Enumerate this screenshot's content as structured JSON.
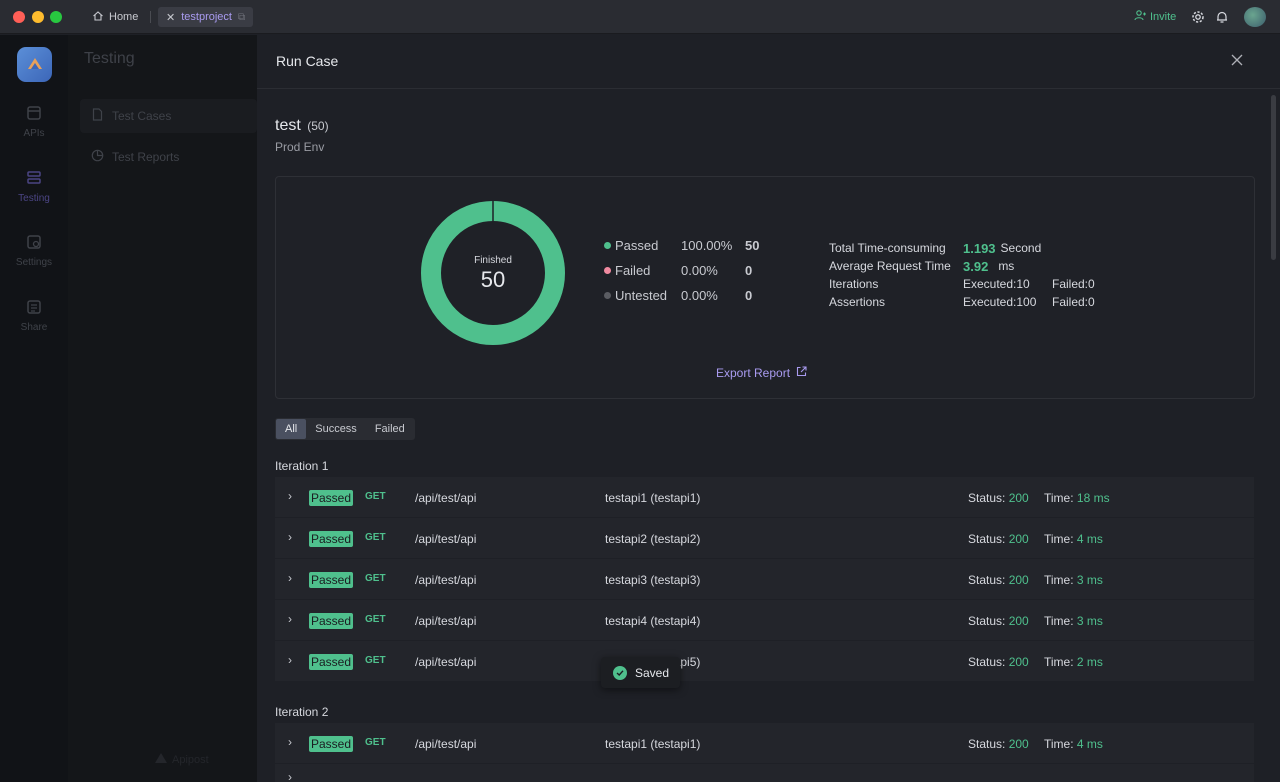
{
  "titlebar": {
    "home_tab": "Home",
    "project_tab": "testproject",
    "invite_label": "Invite"
  },
  "rail": {
    "items": [
      {
        "label": "APIs",
        "icon": "api-icon"
      },
      {
        "label": "Testing",
        "icon": "testing-icon"
      },
      {
        "label": "Settings",
        "icon": "settings-icon"
      },
      {
        "label": "Share",
        "icon": "share-icon"
      }
    ]
  },
  "sidebar": {
    "title": "Testing",
    "items": [
      {
        "label": "Test Cases",
        "icon": "document-icon"
      },
      {
        "label": "Test Reports",
        "icon": "pie-chart-icon"
      }
    ],
    "brand": "Apipost"
  },
  "drawer": {
    "title": "Run Case",
    "case_name": "test",
    "case_count": "(50)",
    "env": "Prod Env"
  },
  "summary": {
    "donut_label": "Finished",
    "donut_value": "50",
    "passed_fraction": 1.0,
    "colors": {
      "passed": "#4fc08d",
      "failed": "#f08aa0",
      "untested": "#5a5c62"
    },
    "legend": [
      {
        "name": "Passed",
        "pct": "100.00%",
        "count": "50"
      },
      {
        "name": "Failed",
        "pct": "0.00%",
        "count": "0"
      },
      {
        "name": "Untested",
        "pct": "0.00%",
        "count": "0"
      }
    ],
    "stats": {
      "time_label": "Total Time-consuming",
      "time_value": "1.193",
      "time_unit": "Second",
      "avg_label": "Average Request Time",
      "avg_value": "3.92",
      "avg_unit": "ms",
      "iter_label": "Iterations",
      "iter_executed": "Executed:10",
      "iter_failed": "Failed:0",
      "assert_label": "Assertions",
      "assert_executed": "Executed:100",
      "assert_failed": "Failed:0"
    },
    "export_label": "Export Report"
  },
  "filter": {
    "all": "All",
    "success": "Success",
    "failed": "Failed"
  },
  "row_labels": {
    "status": "Status:",
    "time": "Time:"
  },
  "iterations": [
    {
      "title": "Iteration 1",
      "rows": [
        {
          "badge": "Passed",
          "method": "GET",
          "path": "/api/test/api",
          "name": "testapi1 (testapi1)",
          "status": "200",
          "time": "18 ms"
        },
        {
          "badge": "Passed",
          "method": "GET",
          "path": "/api/test/api",
          "name": "testapi2 (testapi2)",
          "status": "200",
          "time": "4 ms"
        },
        {
          "badge": "Passed",
          "method": "GET",
          "path": "/api/test/api",
          "name": "testapi3 (testapi3)",
          "status": "200",
          "time": "3 ms"
        },
        {
          "badge": "Passed",
          "method": "GET",
          "path": "/api/test/api",
          "name": "testapi4 (testapi4)",
          "status": "200",
          "time": "3 ms"
        },
        {
          "badge": "Passed",
          "method": "GET",
          "path": "/api/test/api",
          "name": "testapi5 (testapi5)",
          "status": "200",
          "time": "2 ms"
        }
      ]
    },
    {
      "title": "Iteration 2",
      "rows": [
        {
          "badge": "Passed",
          "method": "GET",
          "path": "/api/test/api",
          "name": "testapi1 (testapi1)",
          "status": "200",
          "time": "4 ms"
        }
      ]
    }
  ],
  "toast": {
    "label": "Saved"
  }
}
